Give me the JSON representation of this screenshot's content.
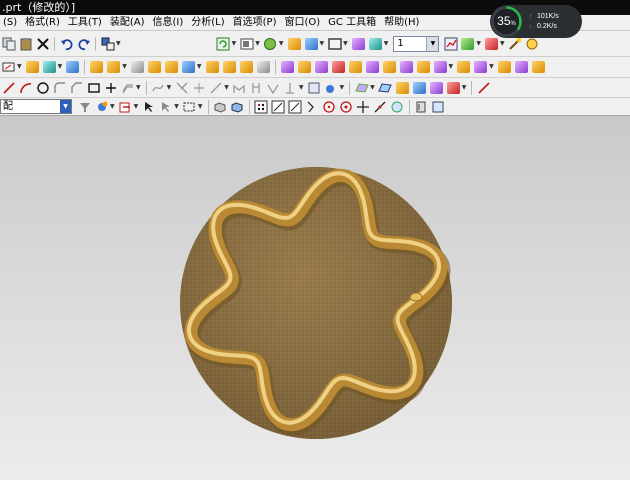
{
  "window": {
    "title": ".prt（修改的）]"
  },
  "menu": {
    "items": [
      "(S)",
      "格式(R)",
      "工具(T)",
      "装配(A)",
      "信息(I)",
      "分析(L)",
      "首选项(P)",
      "窗口(O)",
      "GC 工具箱",
      "帮助(H)"
    ]
  },
  "toolbar": {
    "layer_value": "1",
    "filter_value": "配"
  },
  "system_monitor": {
    "cpu_percent": "35",
    "percent_unit": "%",
    "upload": "101K/s",
    "download": "0.2K/s"
  },
  "colors": {
    "base_disc": "#8e7446",
    "profile_gold": "#d3a94a",
    "viewport_top": "#c9c9c9",
    "viewport_bottom": "#ececec"
  },
  "icons": {
    "row1": [
      "copy-icon",
      "paste-icon",
      "delete-icon",
      "undo-icon",
      "redo-icon",
      "command-finder-icon",
      "refresh-icon",
      "render-style-icon",
      "orient-view-icon",
      "layer-settings-icon",
      "view-icon",
      "move-icon",
      "analysis-icon"
    ],
    "row3": [
      "line-icon",
      "arc-icon",
      "circle-icon",
      "fillet-icon",
      "chamfer-icon",
      "rectangle-icon",
      "point-icon",
      "offset-curve-icon"
    ],
    "row4": [
      "filter-icon",
      "snap-icon",
      "selection-icon",
      "endpoint-icon",
      "midpoint-icon",
      "control-point-icon",
      "intersection-icon",
      "arc-center-icon",
      "quadrant-icon"
    ]
  }
}
